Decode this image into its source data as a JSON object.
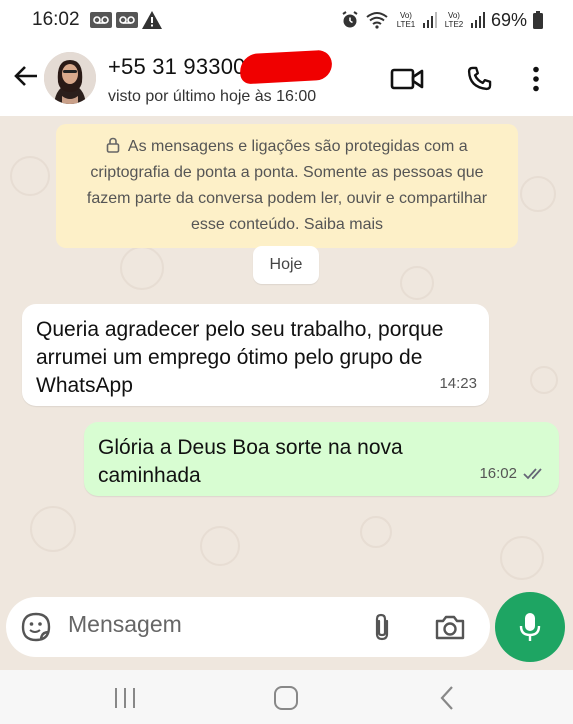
{
  "status_bar": {
    "time": "16:02",
    "battery": "69%",
    "sim1_label": "Vo) LTE1",
    "sim2_label": "Vo) LTE2"
  },
  "header": {
    "contact_name": "+55 31 93300",
    "status": "visto por último hoje às 16:00"
  },
  "chat": {
    "encryption_notice": "As mensagens e ligações são protegidas com a criptografia de ponta a ponta. Somente as pessoas que fazem parte da conversa podem ler, ouvir e compartilhar esse conteúdo. Saiba mais",
    "date_chip": "Hoje",
    "messages": [
      {
        "direction": "incoming",
        "text": "Queria agradecer pelo seu trabalho, porque arrumei um emprego ótimo pelo grupo de WhatsApp",
        "time": "14:23"
      },
      {
        "direction": "outgoing",
        "text": "Glória a Deus Boa sorte na nova caminhada",
        "time": "16:02",
        "status": "read"
      }
    ]
  },
  "input": {
    "placeholder": "Mensagem"
  },
  "colors": {
    "accent": "#1ea563",
    "outgoing_bubble": "#d8fdd2",
    "chat_background": "#efe7de",
    "notice_background": "#fdf0c8",
    "redaction": "#f00000"
  },
  "icons": [
    "arrow-left-icon",
    "video-call-icon",
    "phone-icon",
    "more-vert-icon",
    "lock-icon",
    "sticker-icon",
    "paperclip-icon",
    "camera-icon",
    "mic-icon",
    "double-check-icon",
    "nav-recents-icon",
    "nav-home-icon",
    "nav-back-icon"
  ]
}
